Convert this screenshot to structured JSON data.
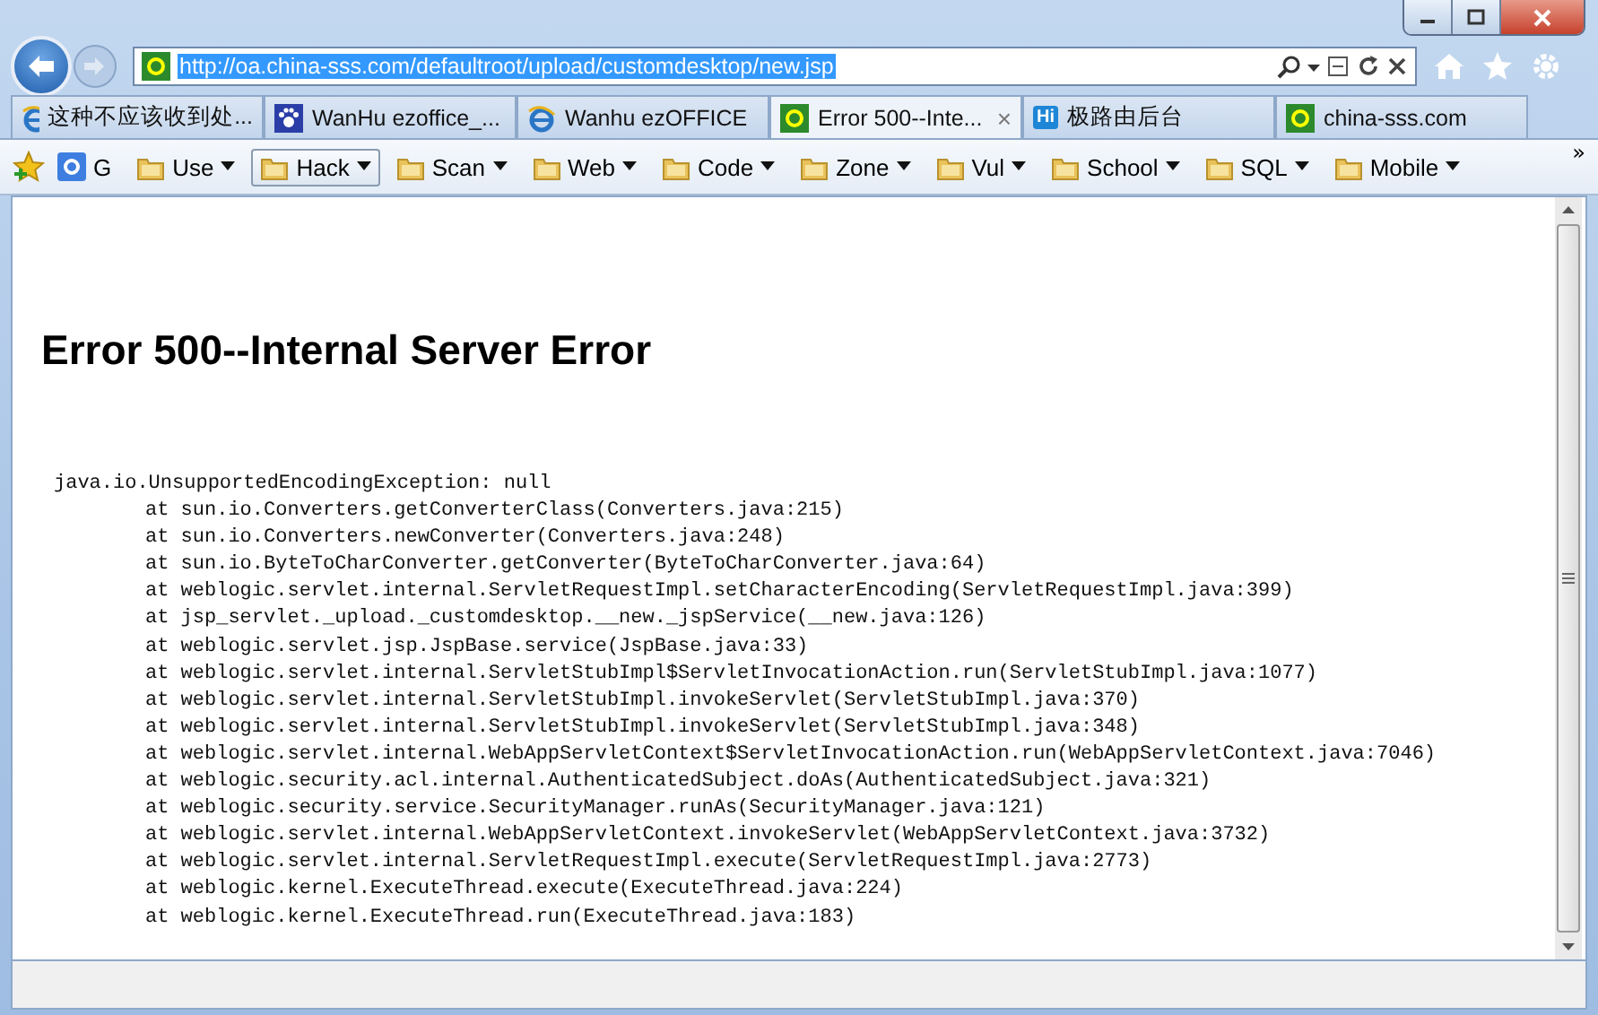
{
  "address_bar": {
    "url": "http://oa.china-sss.com/defaultroot/upload/customdesktop/new.jsp"
  },
  "tabs": [
    {
      "label": "这种不应该收到处...",
      "kind": "ie",
      "selected": false
    },
    {
      "label": "WanHu ezoffice_...",
      "kind": "paw",
      "selected": false
    },
    {
      "label": "Wanhu ezOFFICE",
      "kind": "ie",
      "selected": false
    },
    {
      "label": "Error 500--Inte...",
      "kind": "site",
      "selected": true,
      "close": "×"
    },
    {
      "label": "极路由后台",
      "kind": "badge",
      "badge": "Hi",
      "selected": false
    },
    {
      "label": "china-sss.com",
      "kind": "site",
      "selected": false
    }
  ],
  "favorites": {
    "items": [
      {
        "label": "G",
        "kind": "link",
        "selected": false
      },
      {
        "label": "Use",
        "kind": "folder",
        "selected": false
      },
      {
        "label": "Hack",
        "kind": "folder",
        "selected": true
      },
      {
        "label": "Scan",
        "kind": "folder",
        "selected": false
      },
      {
        "label": "Web",
        "kind": "folder",
        "selected": false
      },
      {
        "label": "Code",
        "kind": "folder",
        "selected": false
      },
      {
        "label": "Zone",
        "kind": "folder",
        "selected": false
      },
      {
        "label": "Vul",
        "kind": "folder",
        "selected": false
      },
      {
        "label": "School",
        "kind": "folder",
        "selected": false
      },
      {
        "label": "SQL",
        "kind": "folder",
        "selected": false
      },
      {
        "label": "Mobile",
        "kind": "folder",
        "selected": false
      }
    ],
    "overflow": "»"
  },
  "page": {
    "heading": "Error 500--Internal Server Error",
    "exception": "java.io.UnsupportedEncodingException: null",
    "frames": [
      "at sun.io.Converters.getConverterClass(Converters.java:215)",
      "at sun.io.Converters.newConverter(Converters.java:248)",
      "at sun.io.ByteToCharConverter.getConverter(ByteToCharConverter.java:64)",
      "at weblogic.servlet.internal.ServletRequestImpl.setCharacterEncoding(ServletRequestImpl.java:399)",
      "at jsp_servlet._upload._customdesktop.__new._jspService(__new.java:126)",
      "at weblogic.servlet.jsp.JspBase.service(JspBase.java:33)",
      "at weblogic.servlet.internal.ServletStubImpl$ServletInvocationAction.run(ServletStubImpl.java:1077)",
      "at weblogic.servlet.internal.ServletStubImpl.invokeServlet(ServletStubImpl.java:370)",
      "at weblogic.servlet.internal.ServletStubImpl.invokeServlet(ServletStubImpl.java:348)",
      "at weblogic.servlet.internal.WebAppServletContext$ServletInvocationAction.run(WebAppServletContext.java:7046)",
      "at weblogic.security.acl.internal.AuthenticatedSubject.doAs(AuthenticatedSubject.java:321)",
      "at weblogic.security.service.SecurityManager.runAs(SecurityManager.java:121)",
      "at weblogic.servlet.internal.WebAppServletContext.invokeServlet(WebAppServletContext.java:3732)",
      "at weblogic.servlet.internal.ServletRequestImpl.execute(ServletRequestImpl.java:2773)",
      "at weblogic.kernel.ExecuteThread.execute(ExecuteThread.java:224)",
      "at weblogic.kernel.ExecuteThread.run(ExecuteThread.java:183)"
    ]
  }
}
